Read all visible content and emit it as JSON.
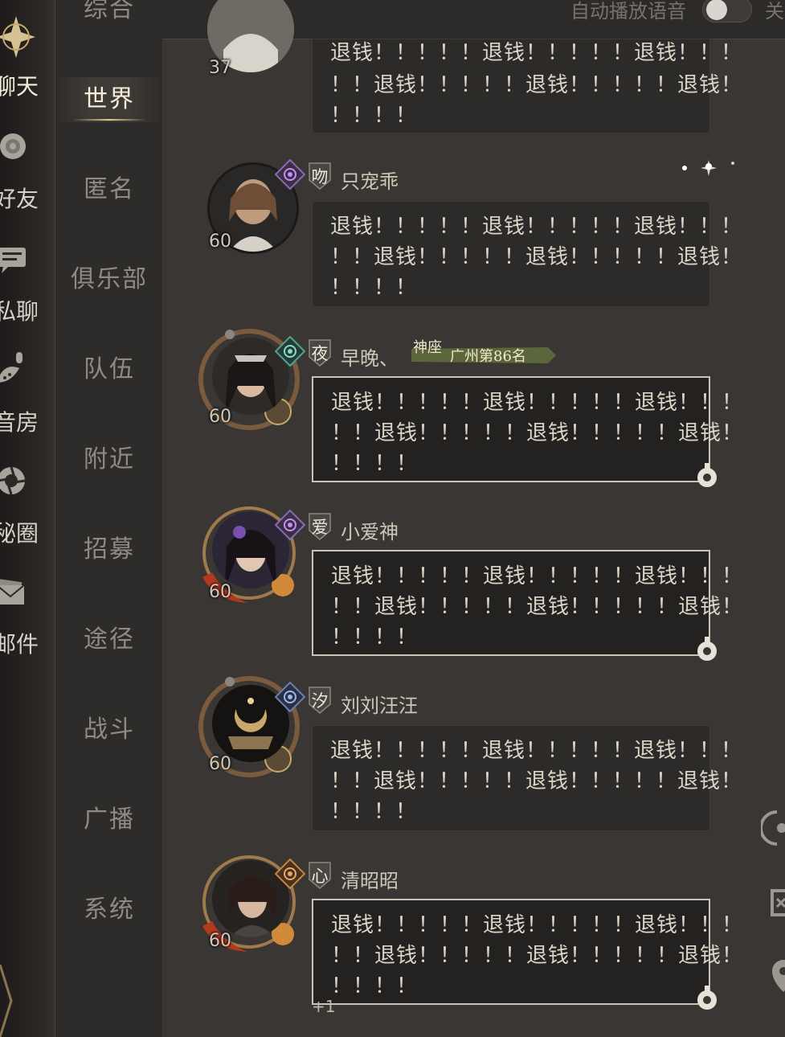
{
  "left_nav": {
    "items": [
      {
        "label": "聊天",
        "icon": "compass-star-icon",
        "active": true
      },
      {
        "label": "好友",
        "icon": "rose-icon"
      },
      {
        "label": "私聊",
        "icon": "chat-bubble-icon"
      },
      {
        "label": "语音房",
        "icon": "microphone-icon"
      },
      {
        "label": "秘圈",
        "icon": "aperture-icon"
      },
      {
        "label": "邮件",
        "icon": "mail-icon"
      }
    ],
    "visible_labels": [
      "聊天",
      "好友",
      "私聊",
      "音房",
      "秘圈",
      "邮件"
    ]
  },
  "channels": {
    "items": [
      {
        "label": "综合"
      },
      {
        "label": "世界",
        "active": true
      },
      {
        "label": "匿名"
      },
      {
        "label": "俱乐部"
      },
      {
        "label": "队伍"
      },
      {
        "label": "附近"
      },
      {
        "label": "招募"
      },
      {
        "label": "途径"
      },
      {
        "label": "战斗"
      },
      {
        "label": "广播"
      },
      {
        "label": "系统"
      }
    ]
  },
  "header": {
    "autoplay_label": "自动播放语音",
    "autoplay_on": false,
    "right_label": "关"
  },
  "messages": [
    {
      "level": "37",
      "badge": "",
      "name": "",
      "lines": [
        "退钱！！！！！退钱！！！！！退钱！！！",
        "！！退钱！！！！！退钱！！！！！退钱！",
        "！！！！"
      ],
      "framed": false
    },
    {
      "level": "60",
      "badge": "吻",
      "name": "只宠乖",
      "lines": [
        "退钱！！！！！退钱！！！！！退钱！！！",
        "！！退钱！！！！！退钱！！！！！退钱！",
        "！！！！"
      ],
      "framed": false,
      "rank_icon": "purple-eye-icon"
    },
    {
      "level": "60",
      "badge": "夜",
      "name": "早晚、",
      "title_small": "神座",
      "title_text": "广州第86名",
      "lines": [
        "退钱！！！！！退钱！！！！！退钱！！！",
        "！！退钱！！！！！退钱！！！！！退钱！",
        "！！！！"
      ],
      "framed": true,
      "rank_icon": "green-eye-icon"
    },
    {
      "level": "60",
      "badge": "爱",
      "name": "小爱神",
      "lines": [
        "退钱！！！！！退钱！！！！！退钱！！！",
        "！！退钱！！！！！退钱！！！！！退钱！",
        "！！！！"
      ],
      "framed": true,
      "rank_icon": "purple-eye-icon"
    },
    {
      "level": "60",
      "badge": "汐",
      "name": "刘刘汪汪",
      "lines": [
        "退钱！！！！！退钱！！！！！退钱！！！",
        "！！退钱！！！！！退钱！！！！！退钱！",
        "！！！！"
      ],
      "framed": false,
      "rank_icon": "blue-eye-icon"
    },
    {
      "level": "60",
      "badge": "心",
      "name": "清昭昭",
      "lines": [
        "退钱！！！！！退钱！！！！！退钱！！！",
        "！！退钱！！！！！退钱！！！！！退钱！",
        "！！！！"
      ],
      "framed": true,
      "rank_icon": "orange-eye-icon",
      "extra": "+1"
    }
  ],
  "colors": {
    "panel_bg": "#393634",
    "nav_bg": "#2e2c2a",
    "gold": "#c9a86a",
    "text_light": "#ddd6c8"
  }
}
